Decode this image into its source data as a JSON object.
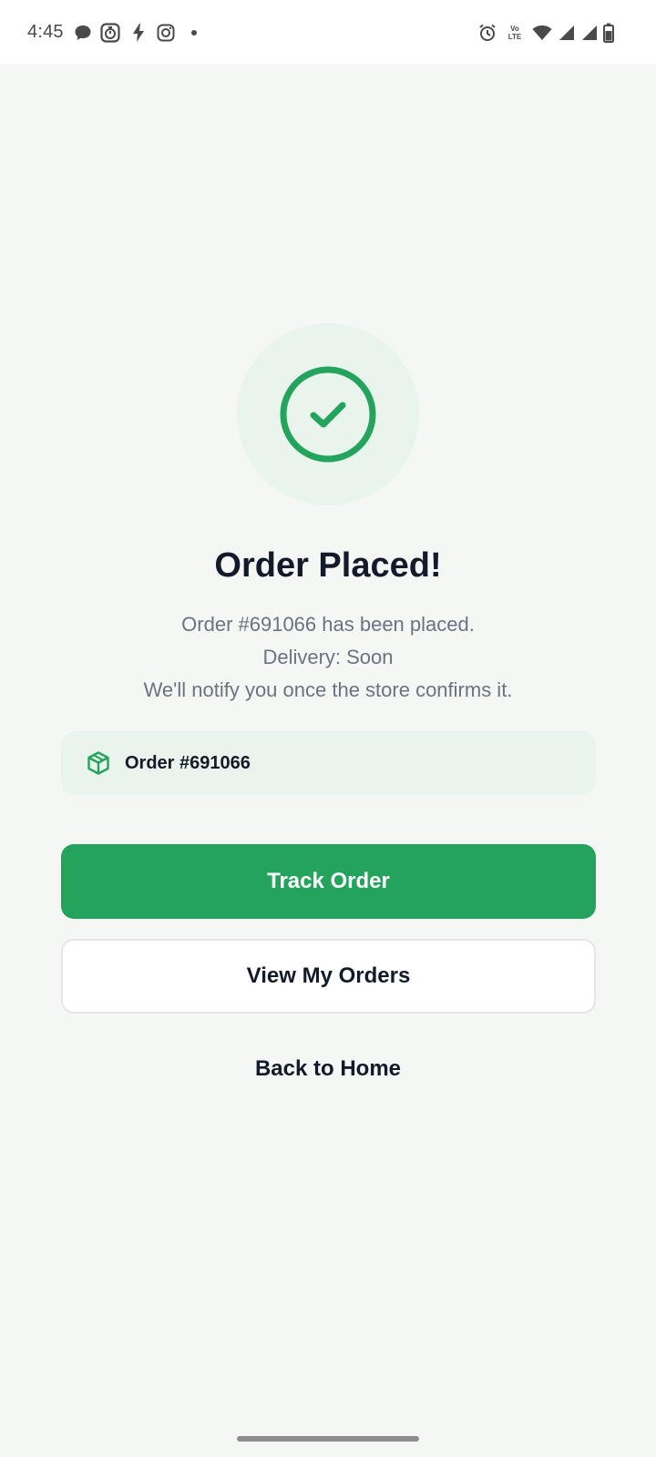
{
  "status_bar": {
    "time": "4:45",
    "left_icons": [
      "chat-bubble-icon",
      "timer-app-icon",
      "bolt-icon",
      "instagram-icon",
      "dot-icon"
    ],
    "right_icons": [
      "alarm-icon",
      "volte-icon",
      "wifi-icon",
      "signal-icon",
      "signal-icon",
      "battery-icon"
    ],
    "volte_text": "Vo LTE"
  },
  "success": {
    "icon": "check-circle-icon",
    "accent": "#23a35c",
    "halo": "#e9f5ec"
  },
  "title": "Order Placed!",
  "messages": {
    "line1": "Order #691066 has been placed.",
    "line2": "Delivery: Soon",
    "line3": "We'll notify you once the store confirms it."
  },
  "order_card": {
    "icon": "package-icon",
    "label": "Order #691066"
  },
  "actions": {
    "track_order": "Track Order",
    "view_orders": "View My Orders",
    "back_home": "Back to Home"
  }
}
